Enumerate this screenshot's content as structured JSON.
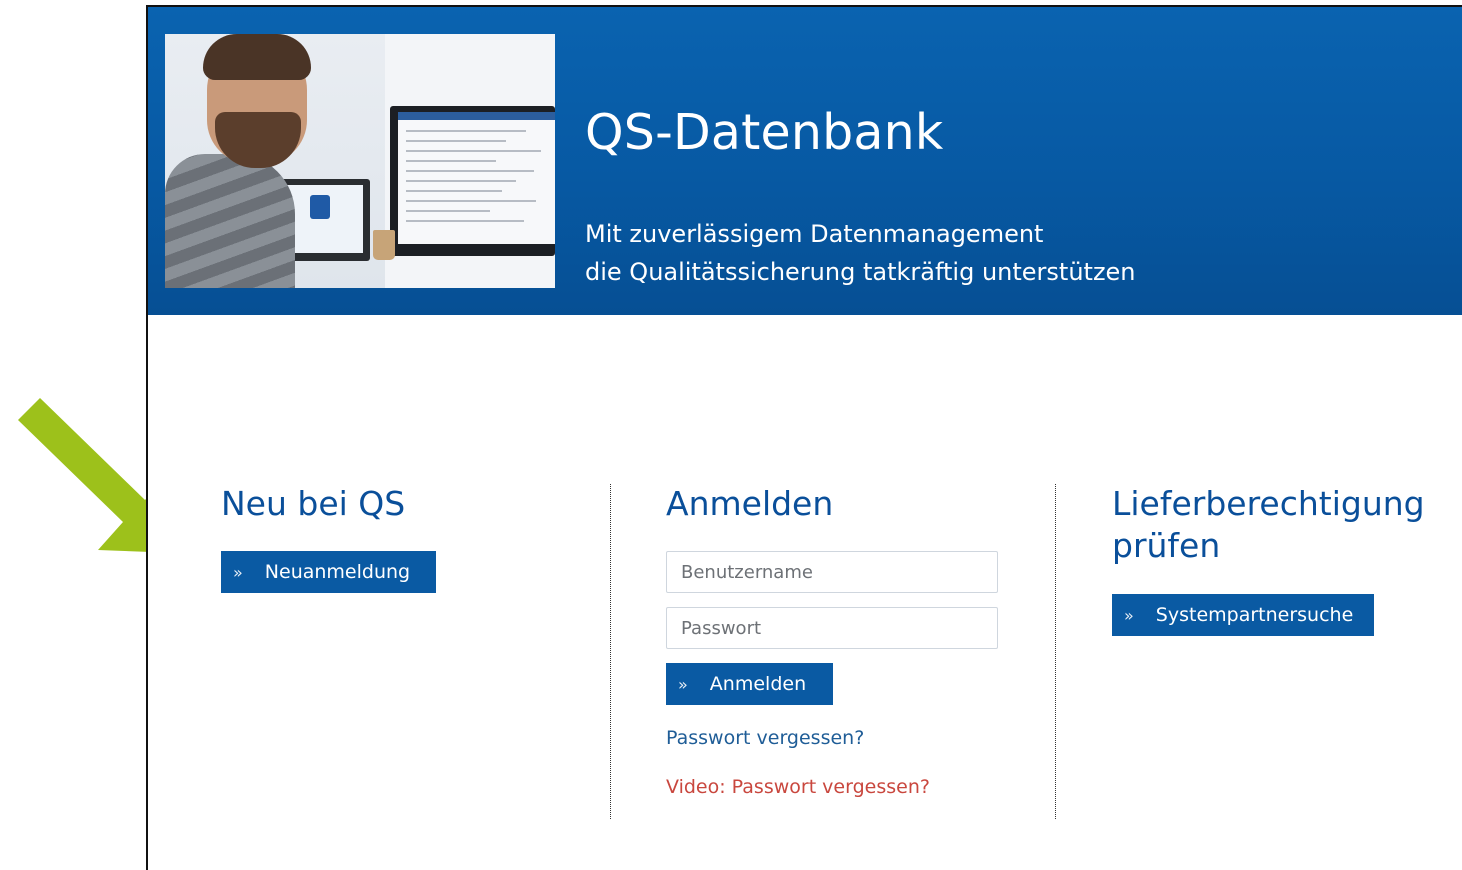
{
  "header": {
    "title": "QS-Datenbank",
    "subtitle_line1": "Mit zuverlässigem Datenmanagement",
    "subtitle_line2": "die Qualitätssicherung tatkräftig unterstützen"
  },
  "new_section": {
    "title": "Neu bei QS",
    "button_label": "Neuanmeldung"
  },
  "login_section": {
    "title": "Anmelden",
    "username_placeholder": "Benutzername",
    "password_placeholder": "Passwort",
    "button_label": "Anmelden",
    "forgot_link": "Passwort vergessen?",
    "video_link": "Video: Passwort vergessen?"
  },
  "supplier_section": {
    "title_line1": "Lieferberechtigung",
    "title_line2": "prüfen",
    "button_label": "Systempartnersuche"
  },
  "icons": {
    "button_chevron": "double-chevron-right-icon",
    "annotation_arrow": "arrow-down-right-icon"
  },
  "colors": {
    "banner": "#0759a3",
    "heading": "#0a4f9a",
    "button": "#0a5aa3",
    "link": "#1f5d97",
    "video_link": "#c9473e",
    "annotation_arrow": "#9dc11b"
  }
}
